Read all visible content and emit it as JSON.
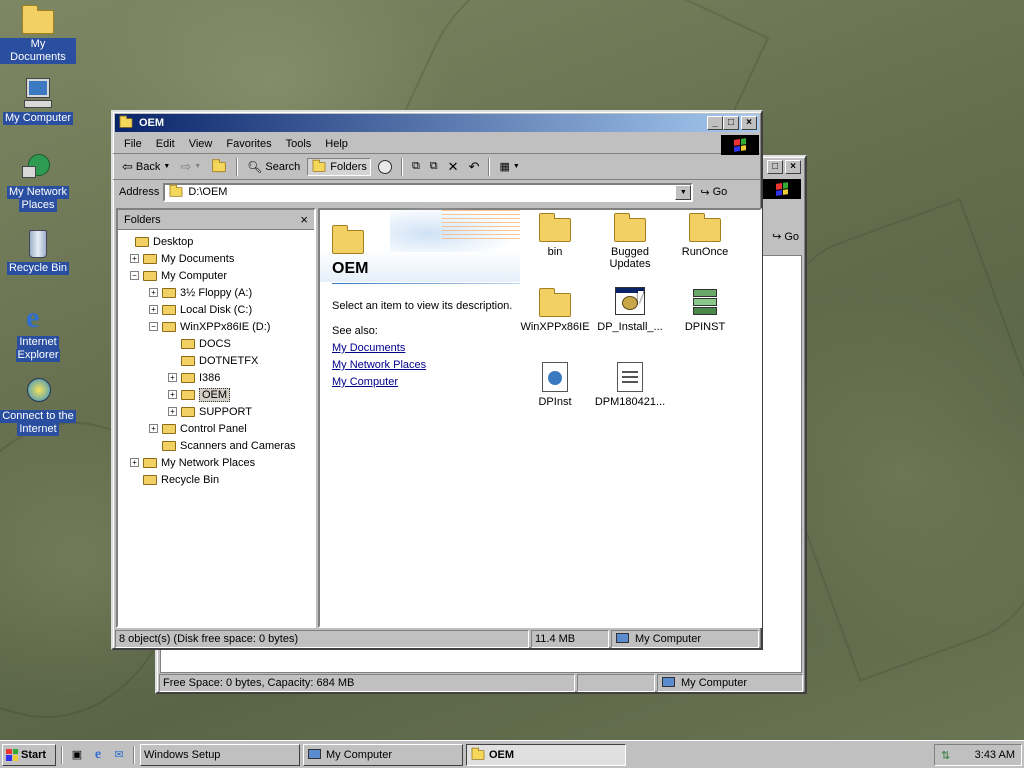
{
  "desktop": {
    "icons": [
      {
        "label_lines": [
          "My Documents"
        ]
      },
      {
        "label_lines": [
          "My Computer"
        ]
      },
      {
        "label_lines": [
          "My Network",
          "Places"
        ]
      },
      {
        "label_lines": [
          "Recycle Bin"
        ]
      },
      {
        "label_lines": [
          "Internet",
          "Explorer"
        ]
      },
      {
        "label_lines": [
          "Connect to the",
          "Internet"
        ]
      }
    ]
  },
  "back_window": {
    "go_label": "Go",
    "status": {
      "left": "Free Space: 0 bytes, Capacity: 684 MB",
      "right": "My Computer"
    }
  },
  "window": {
    "title": "OEM",
    "menu": [
      "File",
      "Edit",
      "View",
      "Favorites",
      "Tools",
      "Help"
    ],
    "toolbar": {
      "back": "Back",
      "search": "Search",
      "folders": "Folders"
    },
    "address": {
      "label": "Address",
      "value": "D:\\OEM",
      "go": "Go"
    },
    "folders_pane": {
      "title": "Folders",
      "tree": [
        {
          "label": "Desktop",
          "level": 0,
          "expander": ""
        },
        {
          "label": "My Documents",
          "level": 1,
          "expander": "+"
        },
        {
          "label": "My Computer",
          "level": 1,
          "expander": "-"
        },
        {
          "label": "3½ Floppy (A:)",
          "level": 2,
          "expander": "+"
        },
        {
          "label": "Local Disk (C:)",
          "level": 2,
          "expander": "+"
        },
        {
          "label": "WinXPPx86IE (D:)",
          "level": 2,
          "expander": "-"
        },
        {
          "label": "DOCS",
          "level": 3,
          "expander": ""
        },
        {
          "label": "DOTNETFX",
          "level": 3,
          "expander": ""
        },
        {
          "label": "I386",
          "level": 3,
          "expander": "+"
        },
        {
          "label": "OEM",
          "level": 3,
          "expander": "+",
          "selected": true
        },
        {
          "label": "SUPPORT",
          "level": 3,
          "expander": "+"
        },
        {
          "label": "Control Panel",
          "level": 2,
          "expander": "+"
        },
        {
          "label": "Scanners and Cameras",
          "level": 2,
          "expander": ""
        },
        {
          "label": "My Network Places",
          "level": 1,
          "expander": "+"
        },
        {
          "label": "Recycle Bin",
          "level": 1,
          "expander": ""
        }
      ]
    },
    "webview": {
      "folder_title": "OEM",
      "description": "Select an item to view its description.",
      "see_also": "See also:",
      "links": [
        "My Documents",
        "My Network Places",
        "My Computer"
      ]
    },
    "files": [
      {
        "label_lines": [
          "bin"
        ],
        "kind": "folder"
      },
      {
        "label_lines": [
          "Bugged",
          "Updates"
        ],
        "kind": "folder"
      },
      {
        "label_lines": [
          "RunOnce"
        ],
        "kind": "folder"
      },
      {
        "label_lines": [
          "WinXPPx86IE"
        ],
        "kind": "folder"
      },
      {
        "label_lines": [
          "DP_Install_..."
        ],
        "kind": "app"
      },
      {
        "label_lines": [
          "DPINST"
        ],
        "kind": "setup"
      },
      {
        "label_lines": [
          "DPInst"
        ],
        "kind": "doc"
      },
      {
        "label_lines": [
          "DPM180421..."
        ],
        "kind": "doc2"
      }
    ],
    "status": {
      "objects": "8 object(s) (Disk free space: 0 bytes)",
      "size": "11.4 MB",
      "zone": "My Computer"
    }
  },
  "taskbar": {
    "start": "Start",
    "tasks": [
      "Windows Setup",
      "My Computer",
      "OEM"
    ],
    "clock": "3:43 AM"
  },
  "colors": {
    "title_active": "#0a246a",
    "face": "#c0c0c0",
    "desktop_label_bg": "#2a4fa0"
  }
}
